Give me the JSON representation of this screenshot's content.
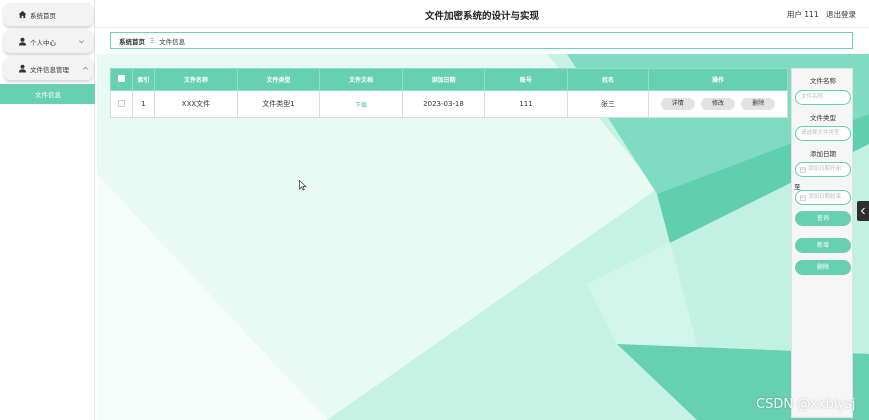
{
  "app": {
    "title": "文件加密系统的设计与实现"
  },
  "header": {
    "user_label": "用户 111",
    "logout_label": "退出登录"
  },
  "sidebar": {
    "items": [
      {
        "label": "系统首页",
        "icon": "home-icon"
      },
      {
        "label": "个人中心",
        "icon": "user-icon"
      },
      {
        "label": "文件信息管理",
        "icon": "user-icon"
      }
    ],
    "subitems": [
      {
        "label": "文件信息",
        "active": true
      }
    ]
  },
  "breadcrumb": {
    "home": "系统首页",
    "separator": "Ξ",
    "current": "文件信息"
  },
  "table": {
    "headers": [
      "索引",
      "文件名称",
      "文件类型",
      "文件文档",
      "添加日期",
      "账号",
      "姓名",
      "操作"
    ],
    "rows": [
      {
        "index": "1",
        "name": "XXX文件",
        "type": "文件类型1",
        "document": "下载",
        "date": "2023-03-18",
        "account": "111",
        "person": "张三",
        "actions": {
          "detail": "详情",
          "edit": "修改",
          "delete": "删除"
        }
      }
    ]
  },
  "filter_panel": {
    "name_label": "文件名称",
    "name_placeholder": "文件名称",
    "type_label": "文件类型",
    "type_placeholder": "请选择文件类型",
    "date_label": "添加日期",
    "date_start_placeholder": "添加日期开始",
    "range_separator": "至",
    "date_end_placeholder": "添加日期结束",
    "search_button": "查询",
    "add_button": "新增",
    "delete_button": "删除"
  },
  "watermark": "CSDN @xxbiysj",
  "colors": {
    "accent": "#66d0b0",
    "accent_light": "#c9f3e6",
    "text": "#333333"
  }
}
